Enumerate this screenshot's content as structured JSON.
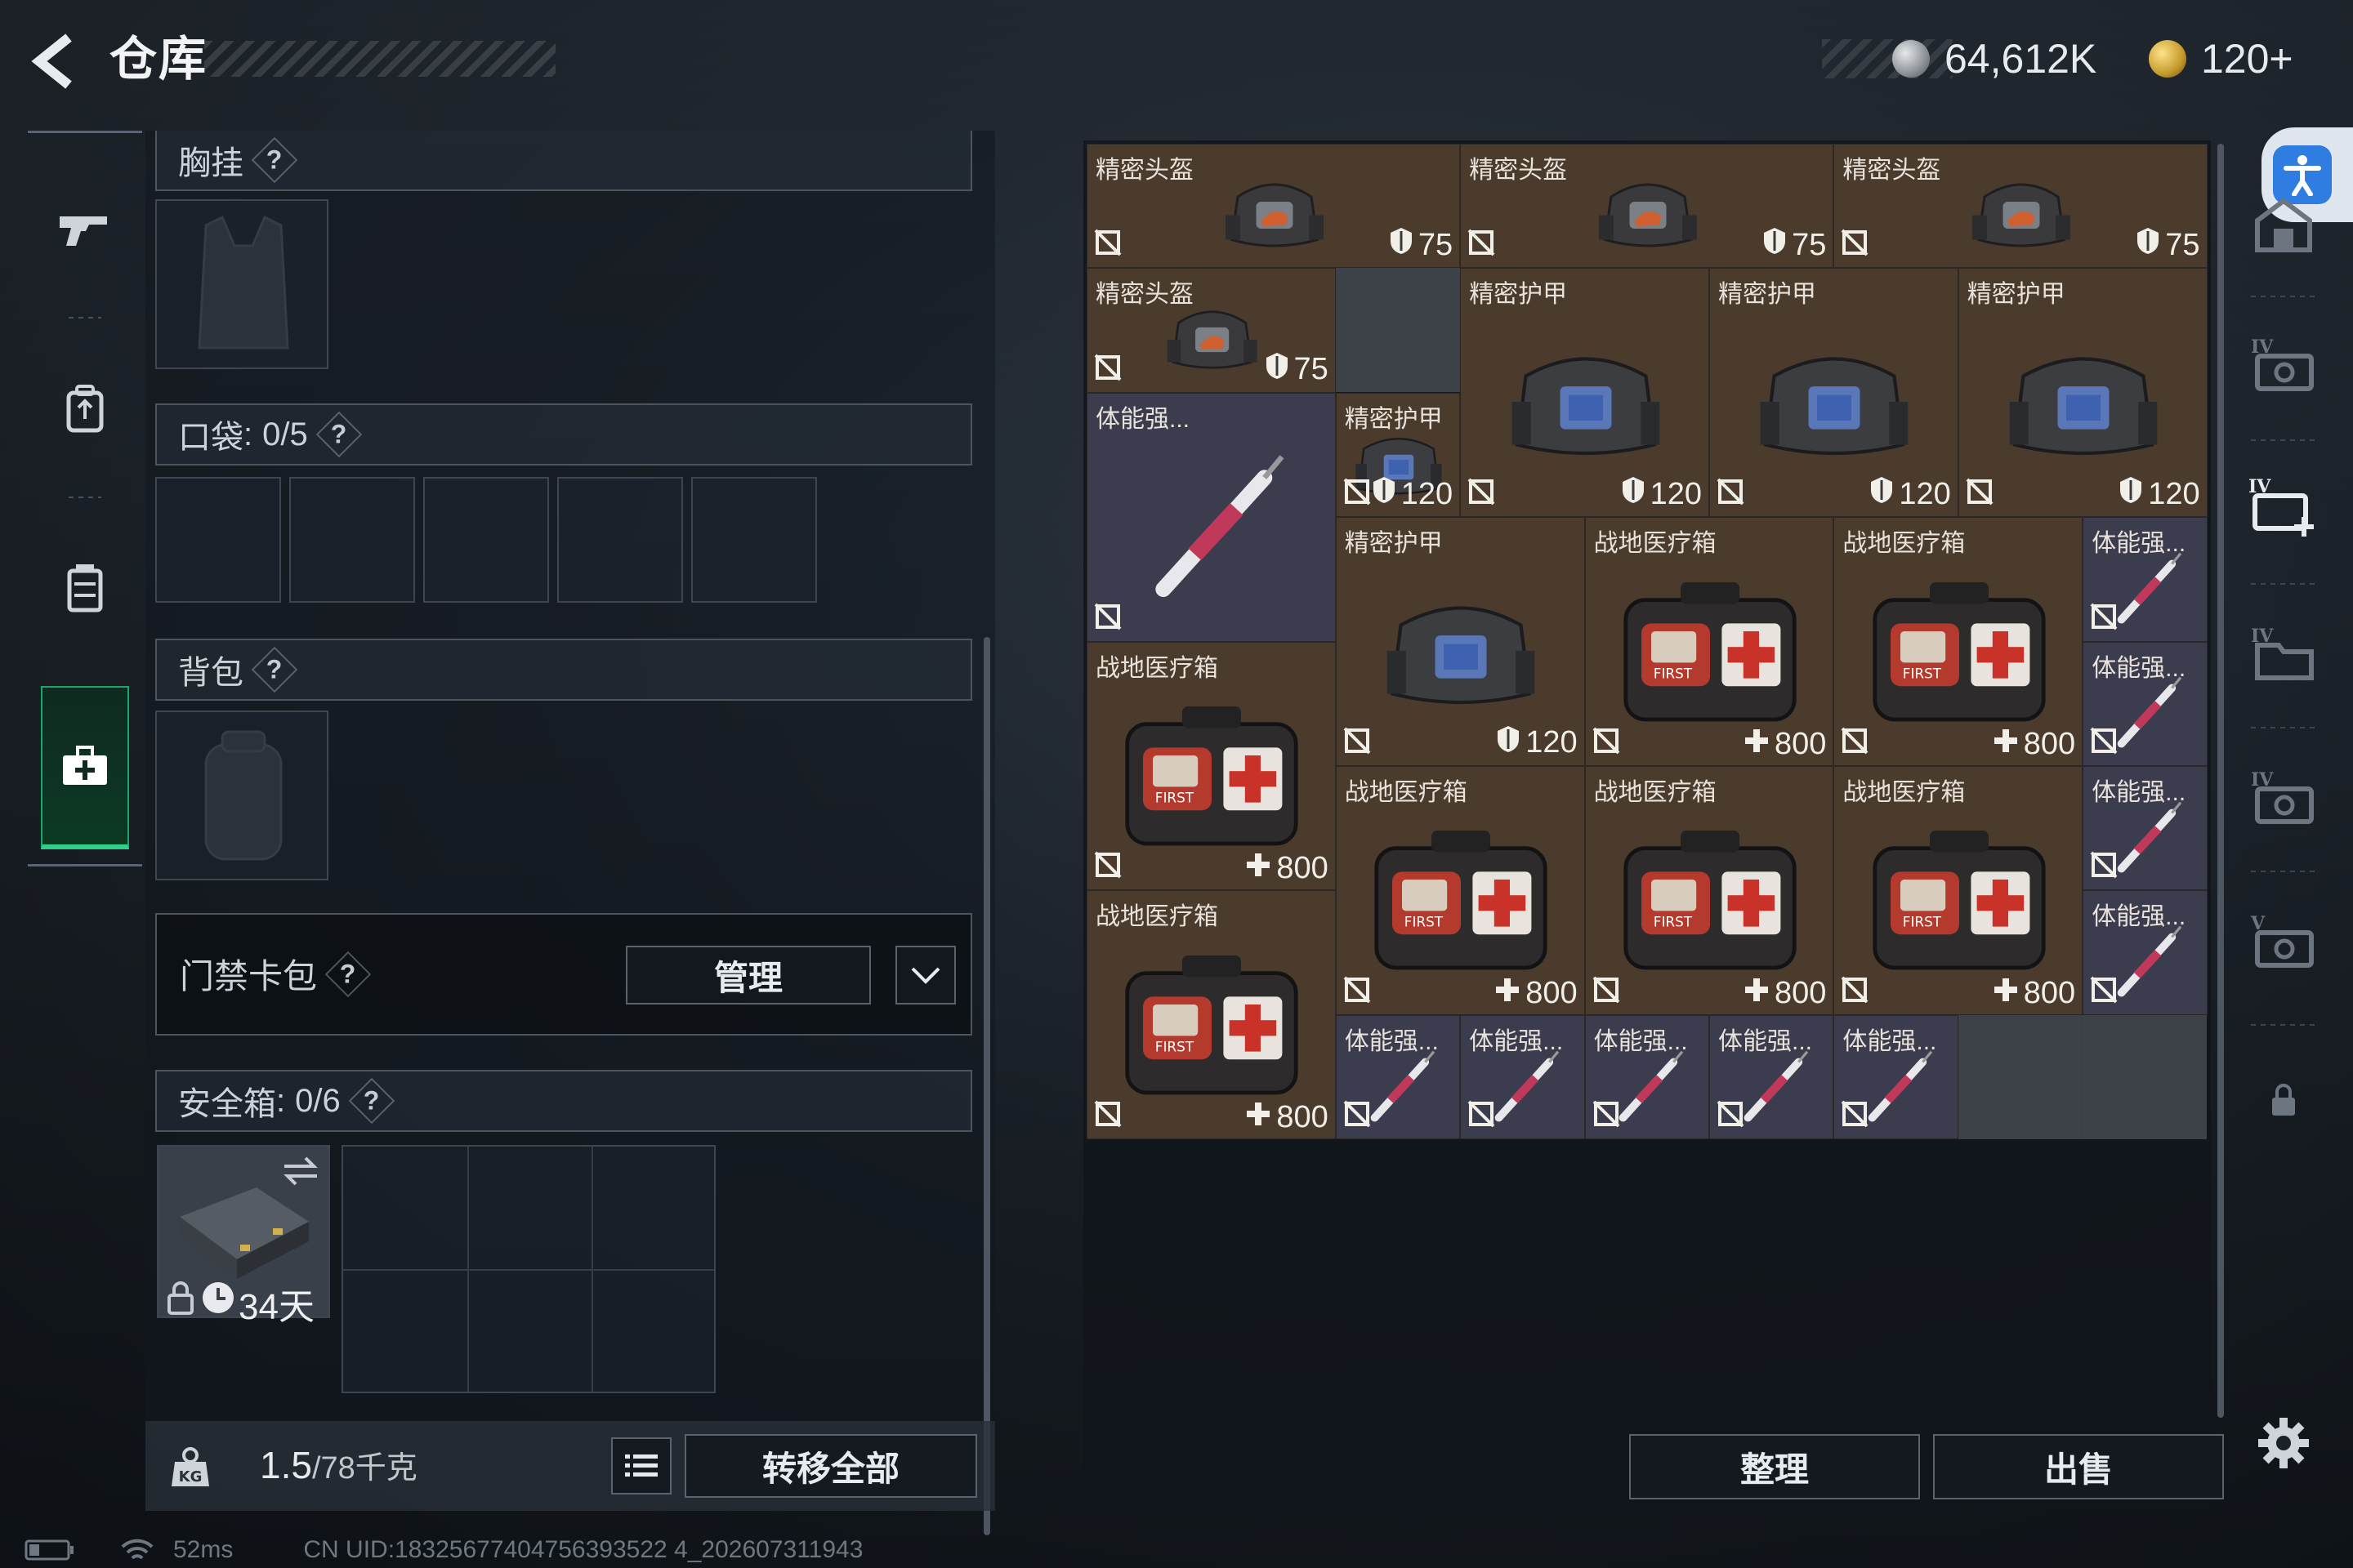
{
  "header": {
    "title": "仓库",
    "currencies": [
      {
        "icon": "coin-silver-icon",
        "value": "64,612K"
      },
      {
        "icon": "coin-gold-icon",
        "value": "120+"
      }
    ]
  },
  "nav": {
    "items": [
      {
        "icon": "gun-icon",
        "active": false
      },
      {
        "icon": "backpack-icon",
        "active": false
      },
      {
        "icon": "vest-icon",
        "active": false
      },
      {
        "icon": "medkit-icon",
        "active": true
      }
    ]
  },
  "equipment": {
    "chest_rig": {
      "label": "胸挂",
      "help": "?"
    },
    "pocket": {
      "label": "口袋",
      "colon": ":",
      "count": "0/5",
      "help": "?"
    },
    "backpack": {
      "label": "背包",
      "help": "?"
    },
    "keycard": {
      "label": "门禁卡包",
      "help": "?",
      "manage": "管理"
    },
    "safebox": {
      "label": "安全箱",
      "colon": ":",
      "count": "0/6",
      "help": "?",
      "duration": "34天"
    }
  },
  "weight": {
    "current": "1.5",
    "capacity": "/78千克"
  },
  "actions": {
    "transfer_all": "转移全部",
    "sort": "整理",
    "sell": "出售"
  },
  "storage_items": [
    {
      "name": "精密头盔",
      "type": "helmet",
      "value": "75",
      "val_icon": "shield"
    },
    {
      "name": "精密头盔",
      "type": "helmet",
      "value": "75",
      "val_icon": "shield"
    },
    {
      "name": "精密头盔",
      "type": "helmet",
      "value": "75",
      "val_icon": "shield"
    },
    {
      "name": "精密头盔",
      "type": "helmet",
      "value": "75",
      "val_icon": "shield"
    },
    {
      "name": "精密护甲",
      "type": "armor",
      "value": "120",
      "val_icon": "shield"
    },
    {
      "name": "精密护甲",
      "type": "armor",
      "value": "120",
      "val_icon": "shield"
    },
    {
      "name": "精密护甲",
      "type": "armor",
      "value": "120",
      "val_icon": "shield"
    },
    {
      "name": "精密护甲",
      "type": "armor",
      "value": "120",
      "val_icon": "shield"
    },
    {
      "name": "体能强...",
      "type": "stim",
      "value": "",
      "val_icon": ""
    },
    {
      "name": "精密护甲",
      "type": "armor",
      "value": "120",
      "val_icon": "shield"
    },
    {
      "name": "战地医疗箱",
      "type": "medkit",
      "value": "800",
      "val_icon": "plus"
    },
    {
      "name": "战地医疗箱",
      "type": "medkit",
      "value": "800",
      "val_icon": "plus"
    },
    {
      "name": "体能强...",
      "type": "stim",
      "value": "",
      "val_icon": ""
    },
    {
      "name": "战地医疗箱",
      "type": "medkit",
      "value": "800",
      "val_icon": "plus"
    },
    {
      "name": "体能强...",
      "type": "stim",
      "value": "",
      "val_icon": ""
    },
    {
      "name": "战地医疗箱",
      "type": "medkit",
      "value": "800",
      "val_icon": "plus"
    },
    {
      "name": "战地医疗箱",
      "type": "medkit",
      "value": "800",
      "val_icon": "plus"
    },
    {
      "name": "战地医疗箱",
      "type": "medkit",
      "value": "800",
      "val_icon": "plus"
    },
    {
      "name": "体能强...",
      "type": "stim",
      "value": "",
      "val_icon": ""
    },
    {
      "name": "战地医疗箱",
      "type": "medkit",
      "value": "800",
      "val_icon": "plus"
    },
    {
      "name": "体能强...",
      "type": "stim",
      "value": "",
      "val_icon": ""
    },
    {
      "name": "体能强...",
      "type": "stim",
      "value": "",
      "val_icon": ""
    },
    {
      "name": "体能强...",
      "type": "stim",
      "value": "",
      "val_icon": ""
    },
    {
      "name": "体能强...",
      "type": "stim",
      "value": "",
      "val_icon": ""
    },
    {
      "name": "体能强...",
      "type": "stim",
      "value": "",
      "val_icon": ""
    },
    {
      "name": "体能强...",
      "type": "stim",
      "value": "",
      "val_icon": ""
    }
  ],
  "right_rail": [
    {
      "icon": "storage-home-icon"
    },
    {
      "icon": "storage-tab-iv-icon"
    },
    {
      "icon": "add-storage-tab-icon"
    },
    {
      "icon": "storage-tab-iv-folder-icon"
    },
    {
      "icon": "storage-tab-iv-icon"
    },
    {
      "icon": "storage-tab-v-icon"
    },
    {
      "icon": "lock-icon"
    },
    {
      "icon": "settings-icon"
    }
  ],
  "status": {
    "ping": "52ms",
    "uid": "CN UID:18325677404756393522 4_202607311943"
  },
  "colors": {
    "accent_green": "#2ed08a",
    "item_bg": "#4a3b2c",
    "stim_bg": "#3b3c4e",
    "accessibility_blue": "#2f7de1"
  }
}
